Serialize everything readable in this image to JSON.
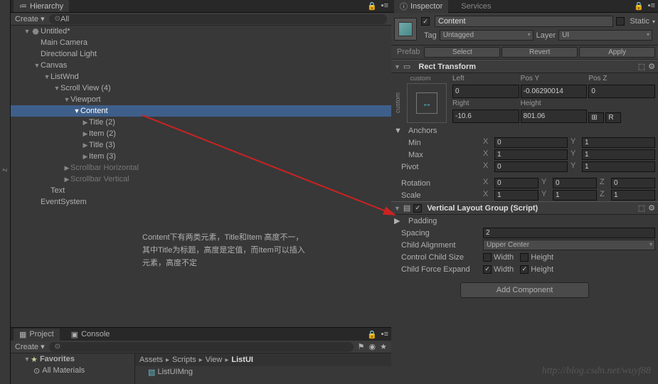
{
  "hierarchy": {
    "tab": "Hierarchy",
    "create": "Create",
    "search": "All",
    "items": [
      {
        "label": "Untitled*",
        "indent": 1,
        "fold": "▼",
        "icon": "⬣"
      },
      {
        "label": "Main Camera",
        "indent": 2
      },
      {
        "label": "Directional Light",
        "indent": 2
      },
      {
        "label": "Canvas",
        "indent": 2,
        "fold": "▼"
      },
      {
        "label": "ListWnd",
        "indent": 3,
        "fold": "▼"
      },
      {
        "label": "Scroll View (4)",
        "indent": 4,
        "fold": "▼"
      },
      {
        "label": "Viewport",
        "indent": 5,
        "fold": "▼"
      },
      {
        "label": "Content",
        "indent": 6,
        "fold": "▼",
        "sel": true
      },
      {
        "label": "Title (2)",
        "indent": 7,
        "fold": "▶"
      },
      {
        "label": "Item (2)",
        "indent": 7,
        "fold": "▶"
      },
      {
        "label": "Title (3)",
        "indent": 7,
        "fold": "▶"
      },
      {
        "label": "Item (3)",
        "indent": 7,
        "fold": "▶"
      },
      {
        "label": "Scrollbar Horizontal",
        "indent": 5,
        "fold": "▶",
        "dim": true
      },
      {
        "label": "Scrollbar Vertical",
        "indent": 5,
        "fold": "▶",
        "dim": true
      },
      {
        "label": "Text",
        "indent": 3
      },
      {
        "label": "EventSystem",
        "indent": 2
      }
    ]
  },
  "project": {
    "tab_project": "Project",
    "tab_console": "Console",
    "create": "Create",
    "fav": "Favorites",
    "mat": "All Materials",
    "crumbs": [
      "Assets",
      "Scripts",
      "View",
      "ListUI"
    ],
    "file": "ListUIMng"
  },
  "inspector": {
    "tab": "Inspector",
    "tab2": "Services",
    "static": "Static",
    "name": "Content",
    "tag_lbl": "Tag",
    "tag": "Untagged",
    "layer_lbl": "Layer",
    "layer": "UI",
    "prefab": "Prefab",
    "select": "Select",
    "revert": "Revert",
    "apply": "Apply"
  },
  "rect": {
    "title": "Rect Transform",
    "custom": "custom",
    "custom_v": "custom",
    "left_l": "Left",
    "left": "0",
    "posy_l": "Pos Y",
    "posy": "-0.06290014",
    "posz_l": "Pos Z",
    "posz": "0",
    "right_l": "Right",
    "right": "-10.6",
    "height_l": "Height",
    "height": "801.06",
    "anchors": "Anchors",
    "min": "Min",
    "max": "Max",
    "pivot": "Pivot",
    "rotation": "Rotation",
    "scale": "Scale",
    "min_x": "0",
    "min_y": "1",
    "max_x": "1",
    "max_y": "1",
    "piv_x": "0",
    "piv_y": "1",
    "rot_x": "0",
    "rot_y": "0",
    "rot_z": "0",
    "sca_x": "1",
    "sca_y": "1",
    "sca_z": "1",
    "R": "R"
  },
  "vlg": {
    "title": "Vertical Layout Group (Script)",
    "padding": "Padding",
    "spacing_l": "Spacing",
    "spacing": "2",
    "align_l": "Child Alignment",
    "align": "Upper Center",
    "ccs": "Control Child Size",
    "cfe": "Child Force Expand",
    "width": "Width",
    "height": "Height"
  },
  "add_component": "Add Component",
  "annot": {
    "l1": "Content下有两类元素，Title和Item 高度不一，",
    "l2": "其中Title为标题，高度是定值，而Item可以插入",
    "l3": "元素，高度不定"
  },
  "watermark": "http://blog.csdn.net/wuyf88",
  "ax": {
    "x": "X",
    "y": "Y",
    "z": "Z"
  }
}
